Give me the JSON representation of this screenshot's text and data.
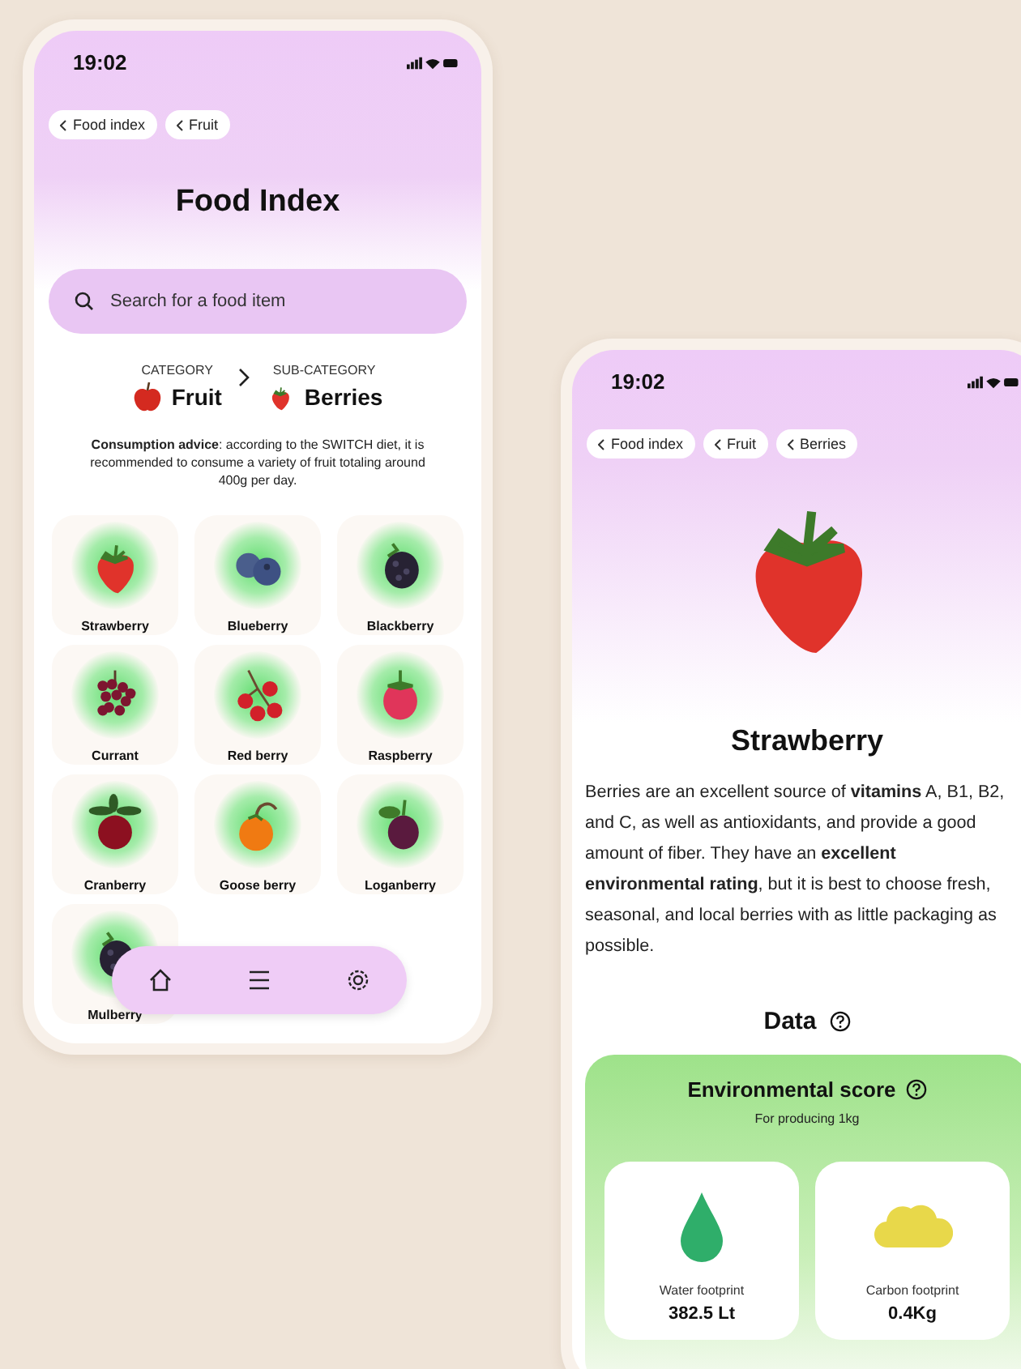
{
  "index_screen": {
    "status_bar": {
      "time": "19:02"
    },
    "breadcrumbs": [
      "Food index",
      "Fruit"
    ],
    "title": "Food Index",
    "search": {
      "placeholder": "Search for a food item"
    },
    "category": {
      "label": "CATEGORY",
      "value": "Fruit"
    },
    "sub_category": {
      "label": "SUB-CATEGORY",
      "value": "Berries"
    },
    "advice": "**Consumption advice**: according to the SWITCH diet, it is recommended to consume a variety of fruit totaling around 400g per day.",
    "foods": [
      {
        "name": "Strawberry",
        "kind": "strawberry"
      },
      {
        "name": "Blueberry",
        "kind": "blueberry"
      },
      {
        "name": "Blackberry",
        "kind": "blackberry"
      },
      {
        "name": "Currant",
        "kind": "currant"
      },
      {
        "name": "Red berry",
        "kind": "redberry"
      },
      {
        "name": "Raspberry",
        "kind": "raspberry"
      },
      {
        "name": "Cranberry",
        "kind": "cranberry"
      },
      {
        "name": "Goose berry",
        "kind": "gooseberry"
      },
      {
        "name": "Loganberry",
        "kind": "loganberry"
      },
      {
        "name": "Mulberry",
        "kind": "blackberry"
      }
    ]
  },
  "detail_screen": {
    "status_bar": {
      "time": "19:02"
    },
    "breadcrumbs": [
      "Food index",
      "Fruit",
      "Berries"
    ],
    "title": "Strawberry",
    "description": "Berries are an excellent source of **vitamins** A, B1, B2, and C, as well as antioxidants, and provide a good amount of fiber. They have an **excellent environmental rating**, but it is best to choose fresh, seasonal, and local berries with as little packaging as possible.",
    "data_heading": "Data",
    "environmental_score": {
      "title": "Environmental score",
      "subtitle": "For producing 1kg",
      "metrics": [
        {
          "kind": "water",
          "label": "Water footprint",
          "value": "382.5 Lt"
        },
        {
          "kind": "carbon",
          "label": "Carbon footprint",
          "value": "0.4Kg"
        }
      ]
    }
  }
}
